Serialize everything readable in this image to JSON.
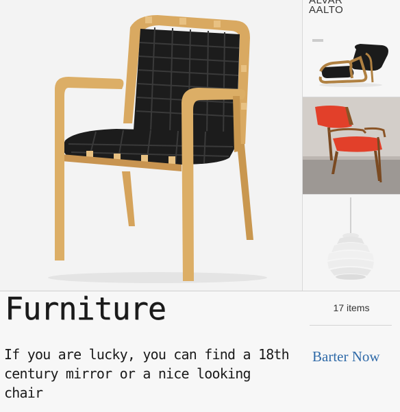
{
  "gallery": {
    "hero_image": "armchair-photo",
    "thumbnails": [
      {
        "image": "lounge-chair-photo",
        "caption": "ALVAR\nAALTO"
      },
      {
        "image": "red-chair-photo"
      },
      {
        "image": "pendant-lamp-photo"
      }
    ]
  },
  "category": {
    "title": "Furniture",
    "description": "If you are lucky, you can find a 18th century mirror or a nice looking chair",
    "count_label": "17 items",
    "action_label": "Barter Now"
  },
  "colors": {
    "link": "#2f6aa8",
    "chair_wood": "#d9a961",
    "chair_webbing": "#1c1c1c",
    "red_seat": "#e2402a"
  }
}
